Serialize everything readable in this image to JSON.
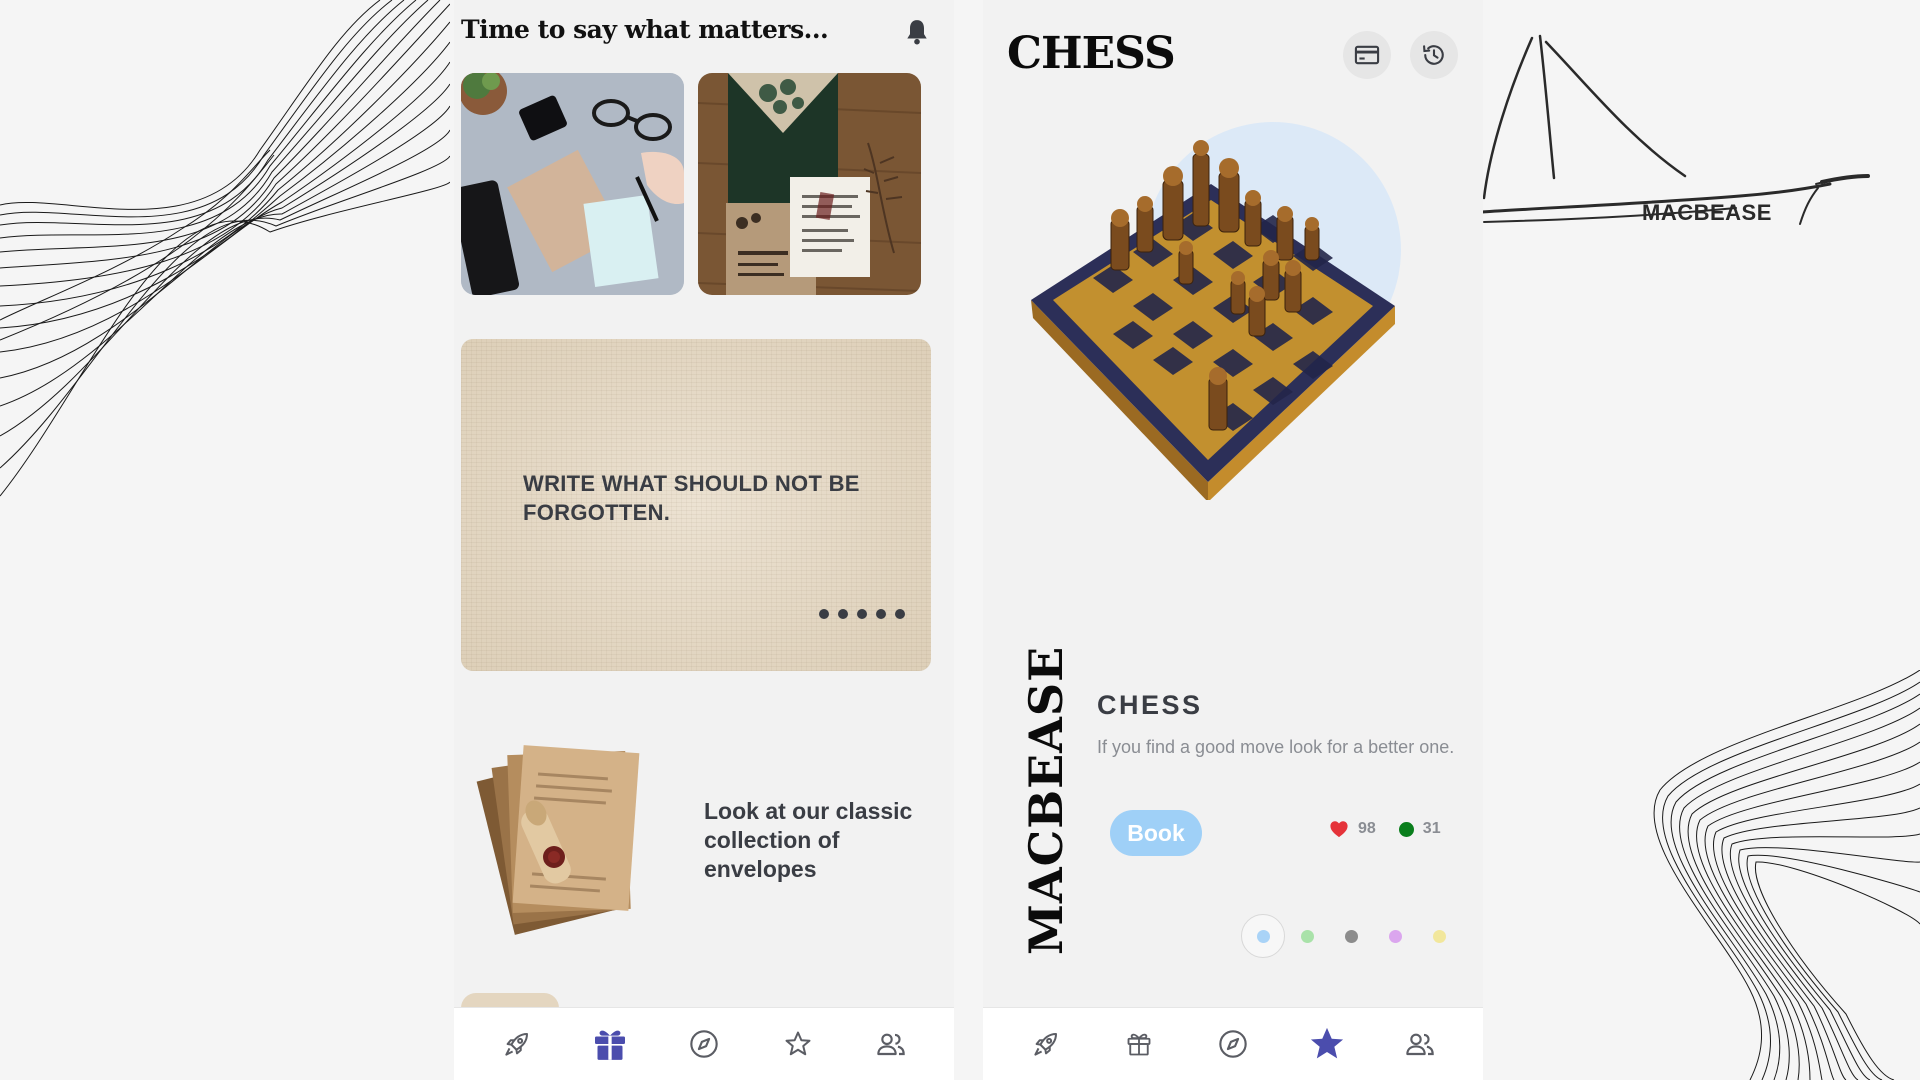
{
  "left_app": {
    "header_title": "Time to say what matters...",
    "hero_text": "WRITE WHAT SHOULD NOT BE FORGOTTEN.",
    "carousel_dot_count": 5,
    "collection_text": "Look at our classic collection of envelopes",
    "nav": {
      "items": [
        "rocket-icon",
        "gift-icon",
        "compass-icon",
        "star-icon",
        "people-icon"
      ],
      "active_index": 1
    }
  },
  "right_app": {
    "title": "CHESS",
    "brand_vertical": "MACBEASE",
    "product_name": "CHESS",
    "product_quote": "If you find a good move look for a better one.",
    "book_label": "Book",
    "likes": "98",
    "online": "31",
    "color_options": [
      "#a9d3f7",
      "#a9e2a9",
      "#8c8c8c",
      "#dba6ee",
      "#f2e79c"
    ],
    "selected_color_index": 0,
    "nav": {
      "items": [
        "rocket-icon",
        "gift-icon",
        "compass-icon",
        "star-icon",
        "people-icon"
      ],
      "active_index": 3
    }
  },
  "logo": {
    "text": "MACBEASE"
  },
  "colors": {
    "accent": "#4b4dad",
    "inactive_icon": "#5b5d64",
    "heart": "#e5333a",
    "online": "#0a7e1c",
    "book": "#9fd0f7"
  }
}
